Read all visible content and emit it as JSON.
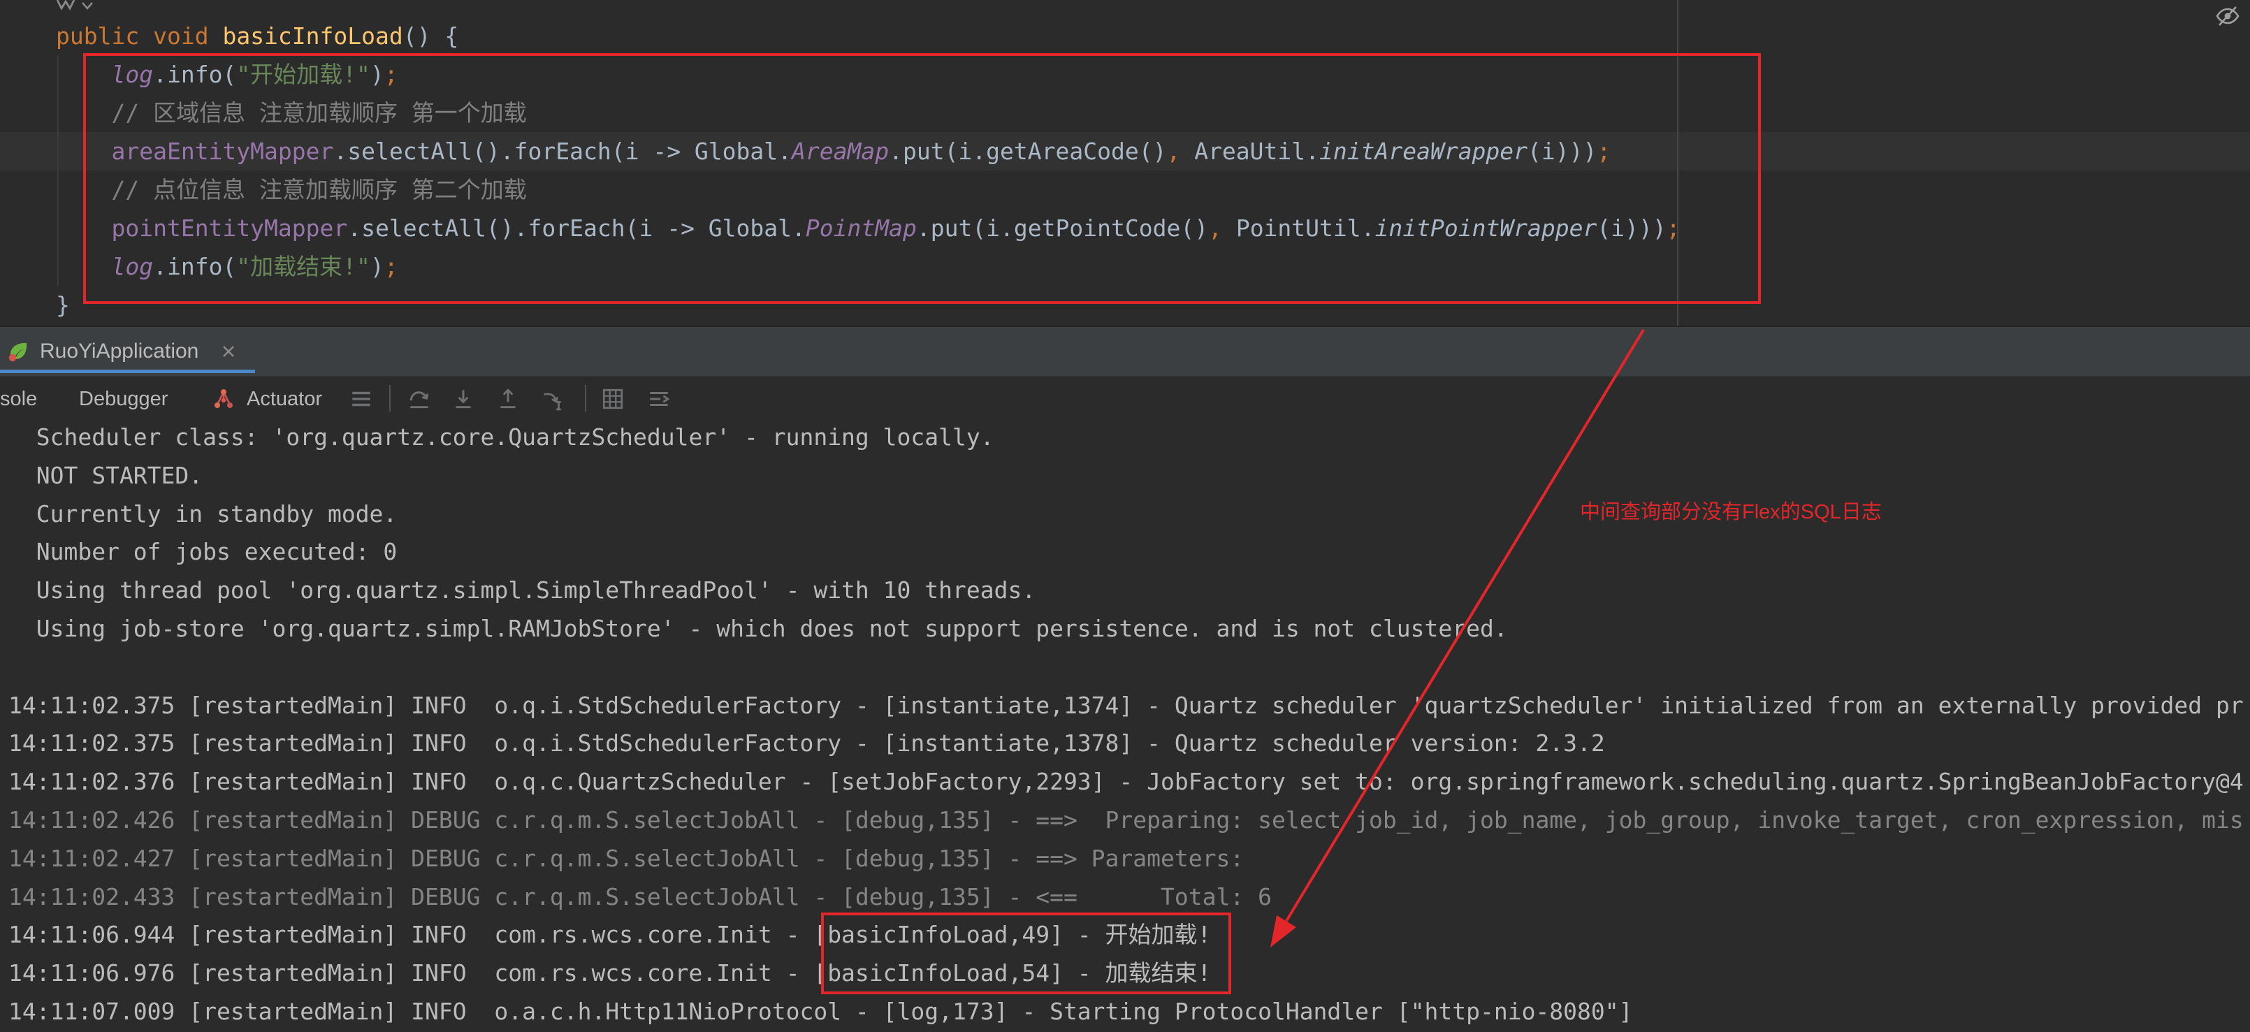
{
  "theme": {
    "editor_bg": "#2b2b2b",
    "panel_bg": "#3c3f41",
    "toolbar_bg": "#2b2b2b",
    "accent": "#4a88c7",
    "annotation": "#e3262a",
    "muted_icon": "#6e7072",
    "text": "#bbbbbb"
  },
  "editor": {
    "icons": {
      "inlay": "code-author-icon",
      "inlay_menu": "chevron-down-icon",
      "reader_mode": "reader-mode-icon"
    },
    "lines": [
      {
        "tokens": [
          {
            "text": "public",
            "color": "#cc7832"
          },
          {
            "text": " ",
            "color": "#a9b7c6"
          },
          {
            "text": "void",
            "color": "#cc7832"
          },
          {
            "text": " ",
            "color": "#a9b7c6"
          },
          {
            "text": "basicInfoLoad",
            "color": "#ffc66d"
          },
          {
            "text": "() {",
            "color": "#a9b7c6"
          }
        ]
      },
      {
        "tokens": [
          {
            "text": "    ",
            "color": "#a9b7c6"
          },
          {
            "text": "log",
            "color": "#9876aa",
            "italic": true
          },
          {
            "text": ".info(",
            "color": "#a9b7c6"
          },
          {
            "text": "\"开始加载!\"",
            "color": "#6a8759"
          },
          {
            "text": ")",
            "color": "#a9b7c6"
          },
          {
            "text": ";",
            "color": "#cc7832"
          }
        ]
      },
      {
        "tokens": [
          {
            "text": "    // 区域信息 注意加载顺序 第一个加载",
            "color": "#808080"
          }
        ]
      },
      {
        "tokens": [
          {
            "text": "    ",
            "color": "#a9b7c6"
          },
          {
            "text": "areaEntityMapper",
            "color": "#9876aa"
          },
          {
            "text": ".selectAll().forEach(i -> Global.",
            "color": "#a9b7c6"
          },
          {
            "text": "AreaMap",
            "color": "#9876aa",
            "italic": true
          },
          {
            "text": ".put(i.getAreaCode()",
            "color": "#a9b7c6"
          },
          {
            "text": ",",
            "color": "#cc7832"
          },
          {
            "text": " AreaUtil.",
            "color": "#a9b7c6"
          },
          {
            "text": "initAreaWrapper",
            "color": "#a9b7c6",
            "italic": true
          },
          {
            "text": "(i)))",
            "color": "#a9b7c6"
          },
          {
            "text": ";",
            "color": "#cc7832"
          }
        ]
      },
      {
        "tokens": [
          {
            "text": "    // 点位信息 注意加载顺序 第二个加载",
            "color": "#808080"
          }
        ]
      },
      {
        "tokens": [
          {
            "text": "    ",
            "color": "#a9b7c6"
          },
          {
            "text": "pointEntityMapper",
            "color": "#9876aa"
          },
          {
            "text": ".selectAll().forEach(i -> Global.",
            "color": "#a9b7c6"
          },
          {
            "text": "PointMap",
            "color": "#9876aa",
            "italic": true
          },
          {
            "text": ".put(i.getPointCode()",
            "color": "#a9b7c6"
          },
          {
            "text": ",",
            "color": "#cc7832"
          },
          {
            "text": " PointUtil.",
            "color": "#a9b7c6"
          },
          {
            "text": "initPointWrapper",
            "color": "#a9b7c6",
            "italic": true
          },
          {
            "text": "(i)))",
            "color": "#a9b7c6"
          },
          {
            "text": ";",
            "color": "#cc7832"
          }
        ]
      },
      {
        "tokens": [
          {
            "text": "    ",
            "color": "#a9b7c6"
          },
          {
            "text": "log",
            "color": "#9876aa",
            "italic": true
          },
          {
            "text": ".info(",
            "color": "#a9b7c6"
          },
          {
            "text": "\"加载结束!\"",
            "color": "#6a8759"
          },
          {
            "text": ")",
            "color": "#a9b7c6"
          },
          {
            "text": ";",
            "color": "#cc7832"
          }
        ]
      },
      {
        "tokens": [
          {
            "text": "}",
            "color": "#a9b7c6"
          }
        ]
      }
    ]
  },
  "run_window": {
    "tab_label": "RuoYiApplication",
    "tab_icon": "spring-boot-icon",
    "tab_close_icon": "close-icon",
    "toolbar_tabs": [
      {
        "label": "sole"
      },
      {
        "label": "Debugger"
      },
      {
        "label": "Actuator",
        "icon": "actuator-icon"
      }
    ],
    "toolbar_icons": [
      "threads-list-icon",
      "step-over-icon",
      "step-into-icon",
      "step-out-icon",
      "run-to-cursor-icon",
      "evaluate-expression-icon",
      "stream-trace-icon"
    ]
  },
  "console": {
    "lines": [
      {
        "text": "  Scheduler class: 'org.quartz.core.QuartzScheduler' - running locally.",
        "color": "#bbbbbb"
      },
      {
        "text": "  NOT STARTED.",
        "color": "#bbbbbb"
      },
      {
        "text": "  Currently in standby mode.",
        "color": "#bbbbbb"
      },
      {
        "text": "  Number of jobs executed: 0",
        "color": "#bbbbbb"
      },
      {
        "text": "  Using thread pool 'org.quartz.simpl.SimpleThreadPool' - with 10 threads.",
        "color": "#bbbbbb"
      },
      {
        "text": "  Using job-store 'org.quartz.simpl.RAMJobStore' - which does not support persistence. and is not clustered.",
        "color": "#bbbbbb"
      },
      {
        "text": "",
        "color": "#bbbbbb"
      },
      {
        "text": "14:11:02.375 [restartedMain] INFO  o.q.i.StdSchedulerFactory - [instantiate,1374] - Quartz scheduler 'quartzScheduler' initialized from an externally provided pr",
        "color": "#bbbbbb"
      },
      {
        "text": "14:11:02.375 [restartedMain] INFO  o.q.i.StdSchedulerFactory - [instantiate,1378] - Quartz scheduler version: 2.3.2",
        "color": "#bbbbbb"
      },
      {
        "text": "14:11:02.376 [restartedMain] INFO  o.q.c.QuartzScheduler - [setJobFactory,2293] - JobFactory set to: org.springframework.scheduling.quartz.SpringBeanJobFactory@4",
        "color": "#bbbbbb"
      },
      {
        "text": "14:11:02.426 [restartedMain] DEBUG c.r.q.m.S.selectJobAll - [debug,135] - ==>  Preparing: select job_id, job_name, job_group, invoke_target, cron_expression, mis",
        "color": "#858585"
      },
      {
        "text": "14:11:02.427 [restartedMain] DEBUG c.r.q.m.S.selectJobAll - [debug,135] - ==> Parameters: ",
        "color": "#858585"
      },
      {
        "text": "14:11:02.433 [restartedMain] DEBUG c.r.q.m.S.selectJobAll - [debug,135] - <==      Total: 6",
        "color": "#858585"
      },
      {
        "text": "14:11:06.944 [restartedMain] INFO  com.rs.wcs.core.Init - [basicInfoLoad,49] - 开始加载!",
        "color": "#bbbbbb"
      },
      {
        "text": "14:11:06.976 [restartedMain] INFO  com.rs.wcs.core.Init - [basicInfoLoad,54] - 加载结束!",
        "color": "#bbbbbb"
      },
      {
        "text": "14:11:07.009 [restartedMain] INFO  o.a.c.h.Http11NioProtocol - [log,173] - Starting ProtocolHandler [\"http-nio-8080\"]",
        "color": "#bbbbbb"
      }
    ]
  },
  "annotation": {
    "note": "中间查询部分没有Flex的SQL日志"
  }
}
